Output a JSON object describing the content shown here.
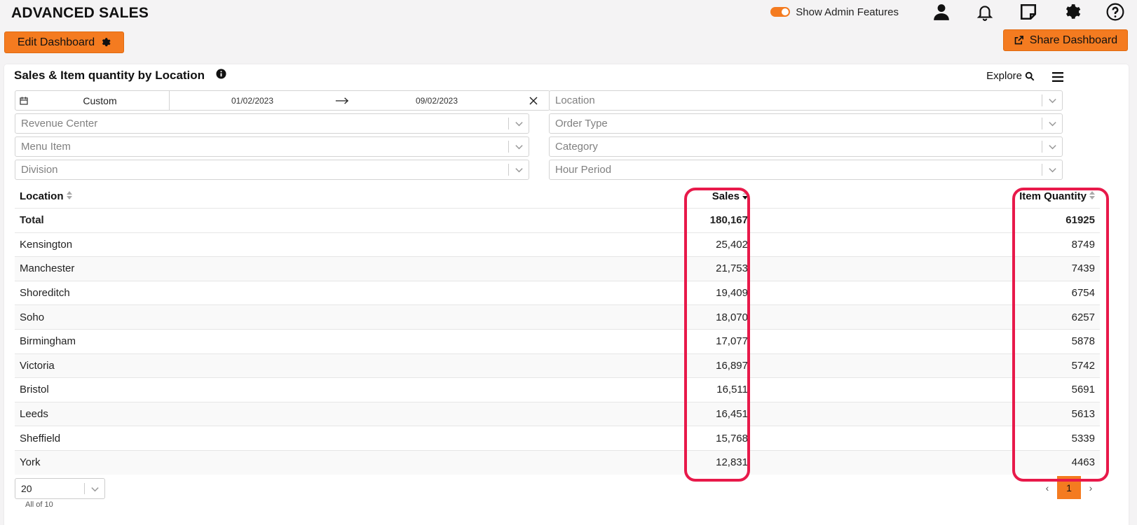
{
  "app": {
    "title": "ADVANCED SALES"
  },
  "topbar": {
    "admin_toggle_label": "Show Admin Features",
    "admin_toggle_on": true
  },
  "toolbar": {
    "edit_label": "Edit Dashboard",
    "share_label": "Share Dashboard"
  },
  "card": {
    "title": "Sales & Item quantity by Location",
    "explore_label": "Explore"
  },
  "filters": {
    "date": {
      "preset": "Custom",
      "start": "01/02/2023",
      "end": "09/02/2023"
    },
    "location": "Location",
    "revenue_center": "Revenue Center",
    "order_type": "Order Type",
    "menu_item": "Menu Item",
    "category": "Category",
    "division": "Division",
    "hour_period": "Hour Period"
  },
  "table": {
    "headers": {
      "location": "Location",
      "sales": "Sales",
      "qty": "Item Quantity"
    },
    "total": {
      "location": "Total",
      "sales": "180,167",
      "qty": "61925"
    },
    "rows": [
      {
        "location": "Kensington",
        "sales": "25,402",
        "qty": "8749"
      },
      {
        "location": "Manchester",
        "sales": "21,753",
        "qty": "7439"
      },
      {
        "location": "Shoreditch",
        "sales": "19,409",
        "qty": "6754"
      },
      {
        "location": "Soho",
        "sales": "18,070",
        "qty": "6257"
      },
      {
        "location": "Birmingham",
        "sales": "17,077",
        "qty": "5878"
      },
      {
        "location": "Victoria",
        "sales": "16,897",
        "qty": "5742"
      },
      {
        "location": "Bristol",
        "sales": "16,511",
        "qty": "5691"
      },
      {
        "location": "Leeds",
        "sales": "16,451",
        "qty": "5613"
      },
      {
        "location": "Sheffield",
        "sales": "15,768",
        "qty": "5339"
      },
      {
        "location": "York",
        "sales": "12,831",
        "qty": "4463"
      }
    ]
  },
  "pager": {
    "page_size": "20",
    "count_label": "All of 10",
    "current_page": "1",
    "prev": "‹",
    "next": "›"
  },
  "colors": {
    "accent": "#f47b20",
    "highlight": "#e8194a"
  }
}
